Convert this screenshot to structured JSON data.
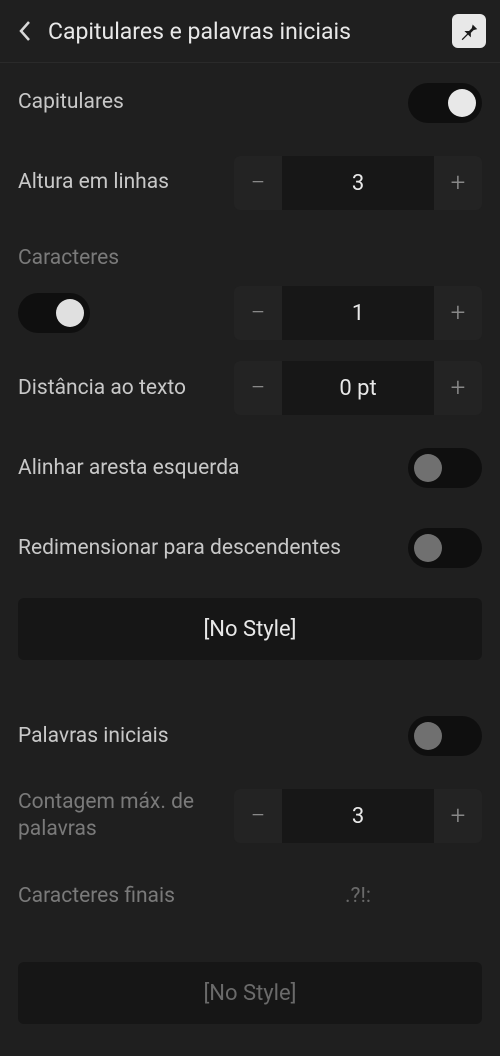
{
  "header": {
    "title": "Capitulares e palavras iniciais"
  },
  "capitulares": {
    "label": "Capitulares",
    "enabled": true
  },
  "altura": {
    "label": "Altura em linhas",
    "value": "3"
  },
  "caracteres": {
    "label": "Caracteres",
    "enabled": true,
    "value": "1"
  },
  "distancia": {
    "label": "Distância ao texto",
    "value": "0 pt"
  },
  "alinhar": {
    "label": "Alinhar aresta esquerda",
    "enabled": false
  },
  "redimensionar": {
    "label": "Redimensionar para descendentes",
    "enabled": false
  },
  "style1": {
    "label": "[No Style]"
  },
  "palavras": {
    "label": "Palavras iniciais",
    "enabled": false
  },
  "contagem": {
    "label": "Contagem máx. de palavras",
    "value": "3"
  },
  "finais": {
    "label": "Caracteres finais",
    "value": ".?!:"
  },
  "style2": {
    "label": "[No Style]"
  }
}
